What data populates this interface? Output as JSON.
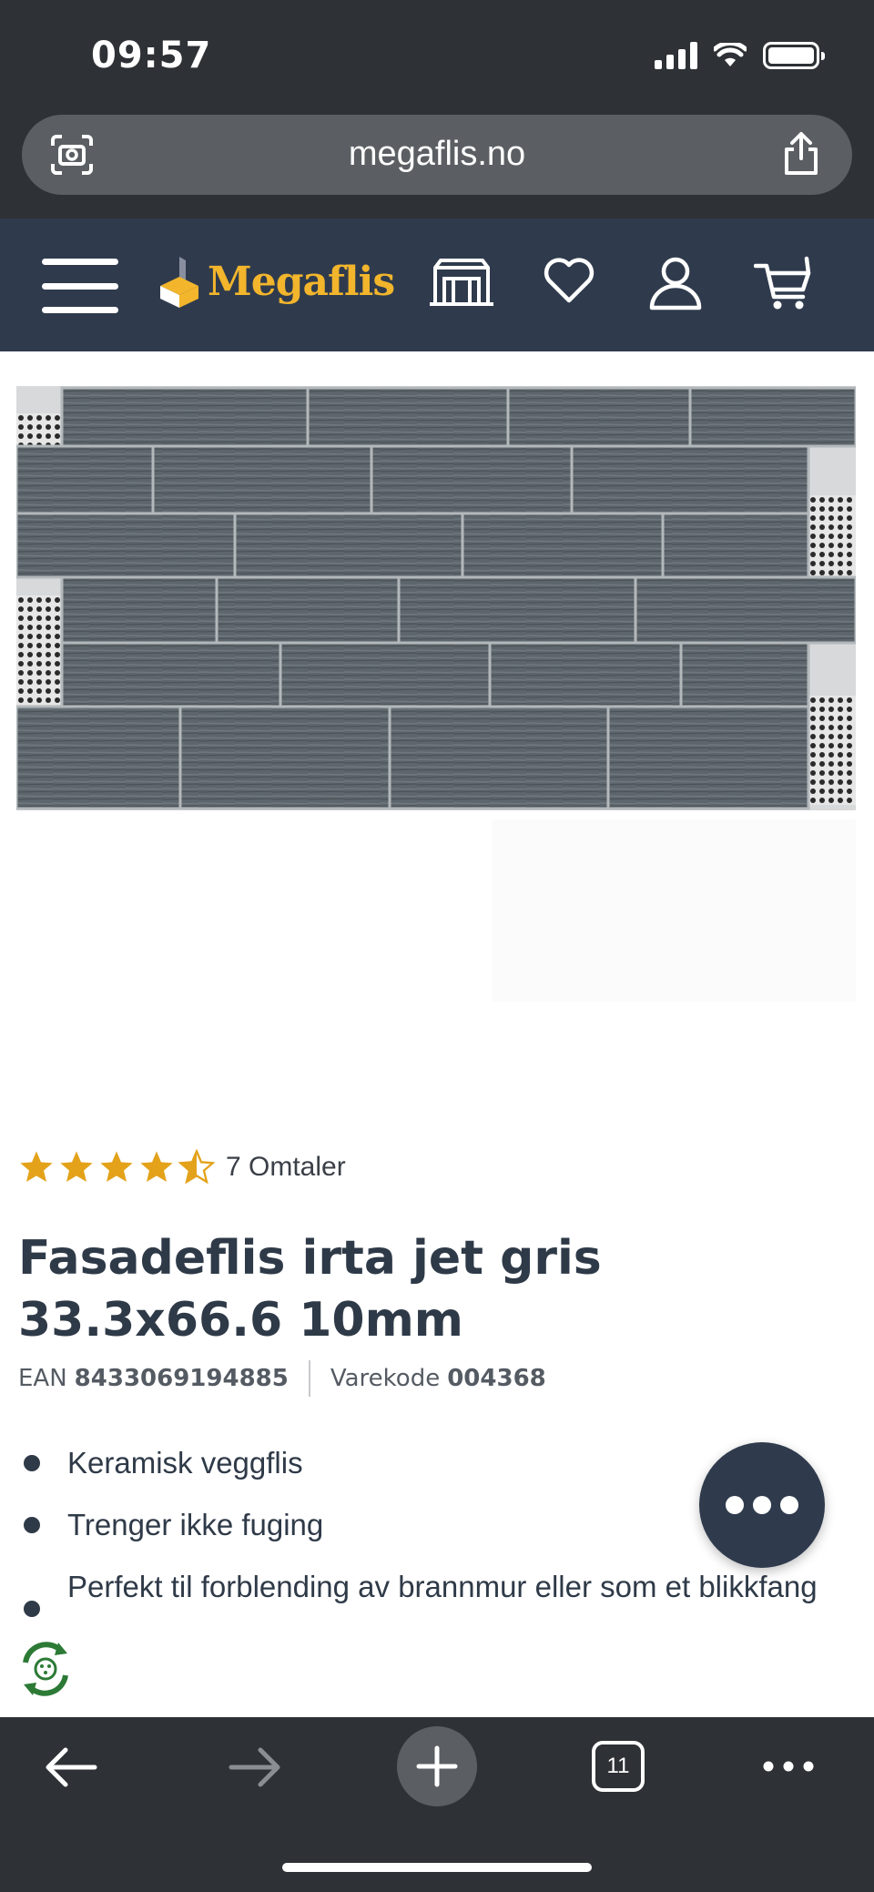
{
  "status_bar": {
    "time": "09:57"
  },
  "browser": {
    "url": "megaflis.no",
    "tab_count": "11"
  },
  "site": {
    "brand_name": "Megaflis",
    "brand_color": "#f2b52c",
    "header_color": "#2f3b4d"
  },
  "product": {
    "rating_value": 4.5,
    "rating_max": 5,
    "reviews_label": "7 Omtaler",
    "title": "Fasadeflis irta jet gris 33.3x66.6 10mm",
    "ean_label": "EAN",
    "ean_value": "8433069194885",
    "code_label": "Varekode",
    "code_value": "004368",
    "features": [
      "Keramisk veggflis",
      "Trenger ikke fuging",
      "Perfekt til forblending av brannmur eller som et blikkfang"
    ]
  },
  "icons": {
    "header": [
      "menu-icon",
      "showroom-icon",
      "heart-icon",
      "user-icon",
      "cart-icon"
    ],
    "browser_bottom": [
      "back-icon",
      "forward-icon",
      "plus-icon",
      "tabs-icon",
      "more-icon"
    ]
  }
}
